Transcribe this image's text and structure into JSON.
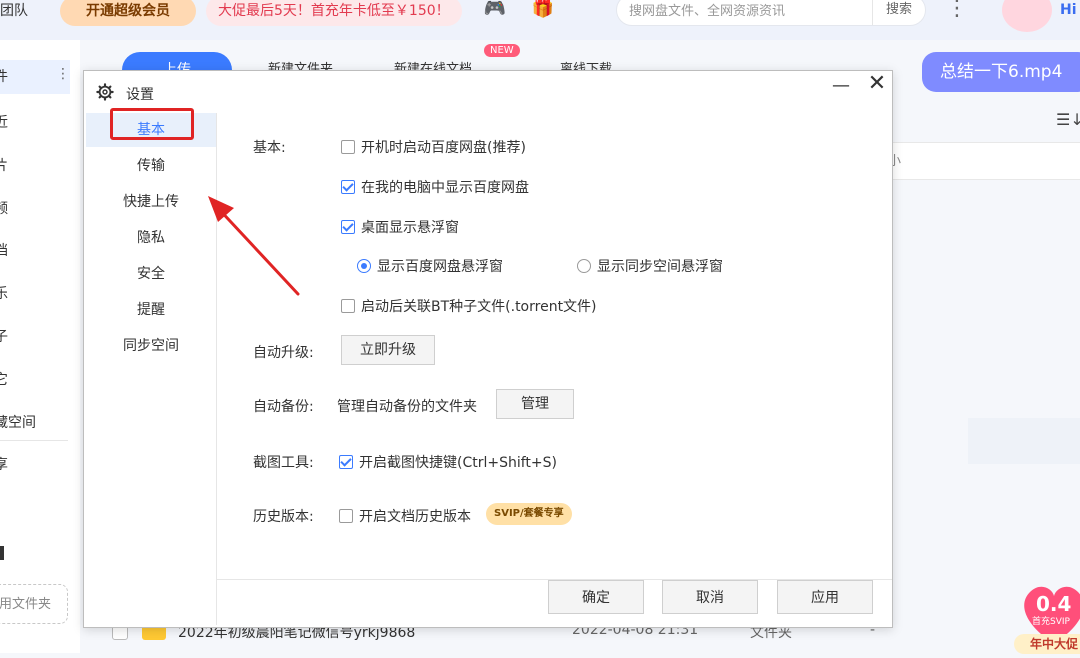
{
  "topbar": {
    "team_label": "团队",
    "vip_label": "开通超级会员",
    "promo_text": "大促最后5天！首充年卡低至￥150！",
    "search": {
      "placeholder": "搜网盘文件、全网资源资讯",
      "button": "搜索"
    },
    "greeting": "Hi"
  },
  "sidebar": {
    "items": [
      {
        "label": "件"
      },
      {
        "label": "近"
      },
      {
        "label": "片"
      },
      {
        "label": "频"
      },
      {
        "label": "档"
      },
      {
        "label": "乐"
      },
      {
        "label": "子"
      },
      {
        "label": "它"
      },
      {
        "label": "藏空间"
      },
      {
        "label": "享"
      },
      {
        "label": "用文件夹"
      }
    ],
    "more": "⋮"
  },
  "toolbar": {
    "upload": "上传",
    "new_folder": "新建文件夹",
    "new_doc": "新建在线文档",
    "offline": "离线下载",
    "new_badge": "NEW"
  },
  "summary_chip": "总结一下6.mp4",
  "file_list": {
    "size_header": "小",
    "row": {
      "name": "2022年初级晨阳笔记微信号yrkj9868",
      "date": "2022-04-08 21:31",
      "type": "文件夹",
      "size": "-"
    }
  },
  "promo_badge": {
    "amount": "0.4",
    "sub": "首充SVIP",
    "ribbon": "年中大促"
  },
  "dialog": {
    "title": "设置",
    "nav": [
      {
        "label": "基本",
        "active": true
      },
      {
        "label": "传输",
        "active": false
      },
      {
        "label": "快捷上传",
        "active": false
      },
      {
        "label": "隐私",
        "active": false
      },
      {
        "label": "安全",
        "active": false
      },
      {
        "label": "提醒",
        "active": false
      },
      {
        "label": "同步空间",
        "active": false
      }
    ],
    "sections": {
      "basic": {
        "label": "基本:",
        "options": [
          {
            "label": "开机时启动百度网盘(推荐)",
            "checked": false
          },
          {
            "label": "在我的电脑中显示百度网盘",
            "checked": true
          },
          {
            "label": "桌面显示悬浮窗",
            "checked": true
          },
          {
            "label": "启动后关联BT种子文件(.torrent文件)",
            "checked": false
          }
        ],
        "float_radios": [
          {
            "label": "显示百度网盘悬浮窗",
            "selected": true
          },
          {
            "label": "显示同步空间悬浮窗",
            "selected": false
          }
        ]
      },
      "auto_upgrade": {
        "label": "自动升级:",
        "button": "立即升级"
      },
      "auto_backup": {
        "label": "自动备份:",
        "desc": "管理自动备份的文件夹",
        "button": "管理"
      },
      "screenshot": {
        "label": "截图工具:",
        "option": "开启截图快捷键(Ctrl+Shift+S)",
        "checked": true
      },
      "history": {
        "label": "历史版本:",
        "option": "开启文档历史版本",
        "checked": false,
        "badge": "SVIP/套餐专享"
      }
    },
    "footer": {
      "ok": "确定",
      "cancel": "取消",
      "apply": "应用"
    }
  },
  "colors": {
    "accent": "#3b7bff",
    "highlight": "#e02424"
  }
}
